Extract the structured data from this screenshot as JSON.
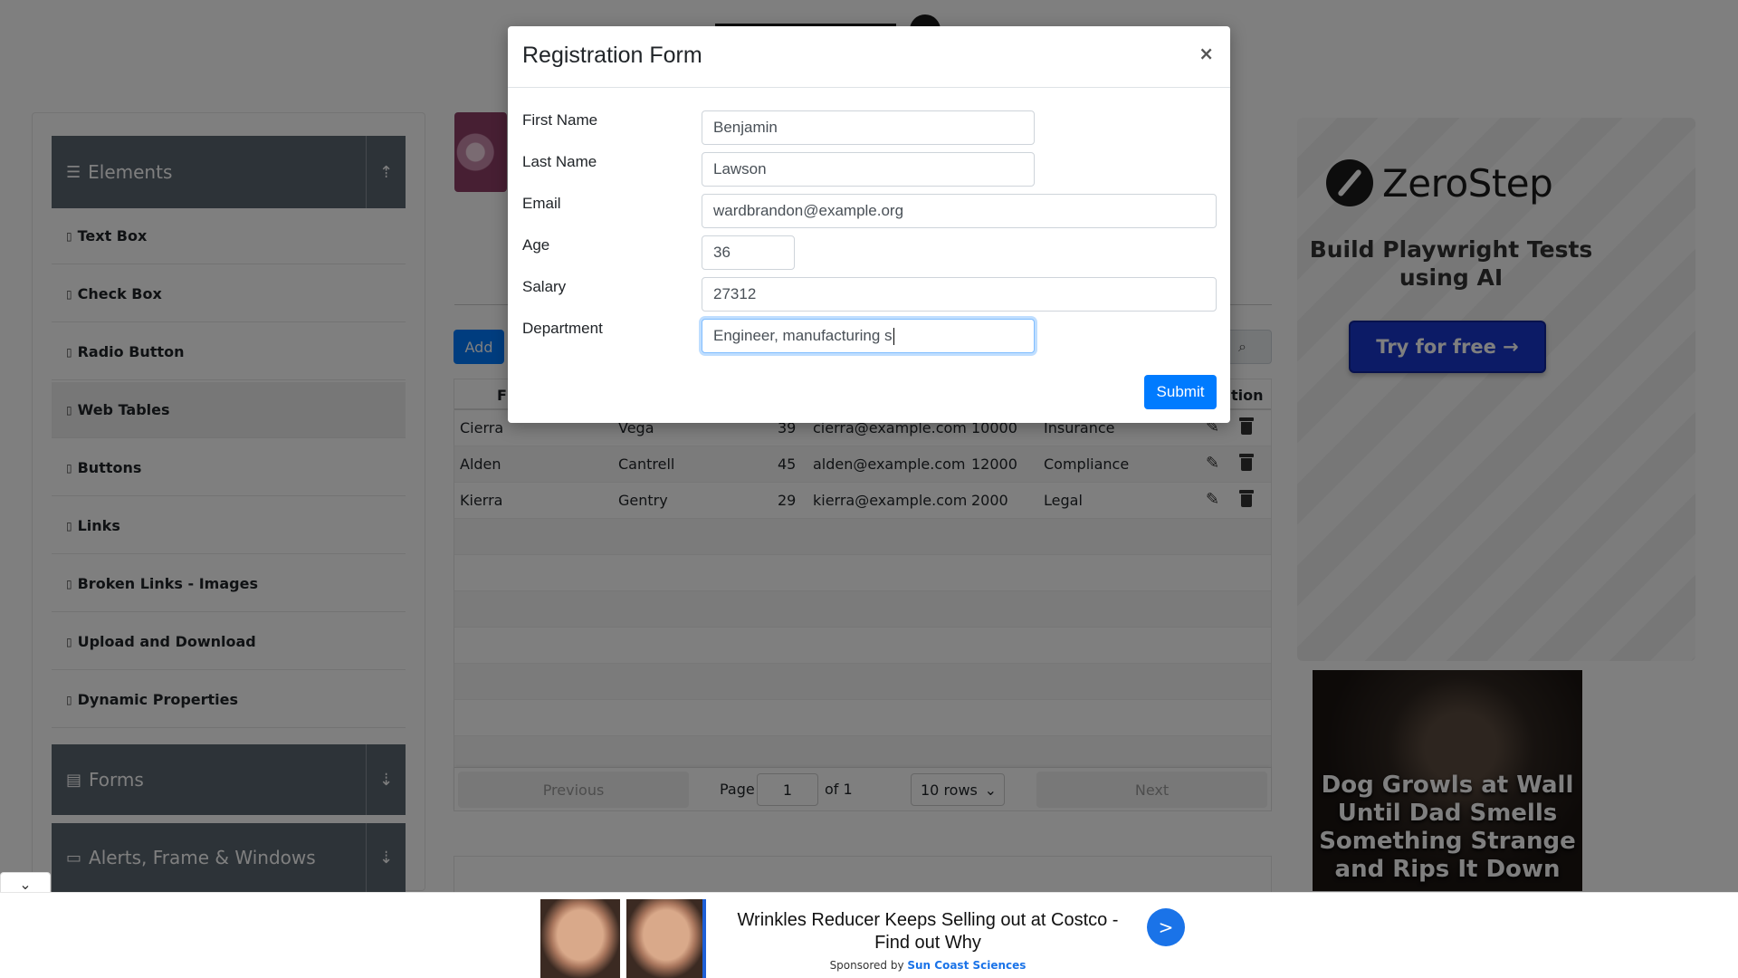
{
  "sidebar": {
    "elements_group": {
      "label": "Elements"
    },
    "items": [
      {
        "label": "Text Box"
      },
      {
        "label": "Check Box"
      },
      {
        "label": "Radio Button"
      },
      {
        "label": "Web Tables"
      },
      {
        "label": "Buttons"
      },
      {
        "label": "Links"
      },
      {
        "label": "Broken Links - Images"
      },
      {
        "label": "Upload and Download"
      },
      {
        "label": "Dynamic Properties"
      }
    ],
    "forms_group": {
      "label": "Forms"
    },
    "alerts_group": {
      "label": "Alerts, Frame & Windows"
    },
    "active_item": "Web Tables"
  },
  "toolbar": {
    "add_label": "Add"
  },
  "table": {
    "visible_header_fragments": {
      "first": "Fi",
      "last": "tion"
    },
    "rows": [
      {
        "first": "Cierra",
        "last": "Vega",
        "age": "39",
        "email": "cierra@example.com",
        "salary": "10000",
        "department": "Insurance"
      },
      {
        "first": "Alden",
        "last": "Cantrell",
        "age": "45",
        "email": "alden@example.com",
        "salary": "12000",
        "department": "Compliance"
      },
      {
        "first": "Kierra",
        "last": "Gentry",
        "age": "29",
        "email": "kierra@example.com",
        "salary": "2000",
        "department": "Legal"
      }
    ],
    "pagination": {
      "previous": "Previous",
      "page_label": "Page",
      "page_value": "1",
      "of_label": "of 1",
      "rows_select": "10 rows",
      "next": "Next"
    }
  },
  "modal": {
    "title": "Registration Form",
    "close": "×",
    "fields": {
      "first_name": {
        "label": "First Name",
        "value": "Benjamin"
      },
      "last_name": {
        "label": "Last Name",
        "value": "Lawson"
      },
      "email": {
        "label": "Email",
        "value": "wardbrandon@example.org"
      },
      "age": {
        "label": "Age",
        "value": "36"
      },
      "salary": {
        "label": "Salary",
        "value": "27312"
      },
      "department": {
        "label": "Department",
        "value": "Engineer, manufacturing s"
      }
    },
    "submit_label": "Submit"
  },
  "ads": {
    "zerostep": {
      "brand": "ZeroStep",
      "tagline": "Build Playwright Tests using AI",
      "cta": "Try for free →"
    },
    "dog": {
      "headline": "Dog Growls at Wall Until Dad Smells Something Strange and Rips It Down"
    },
    "bottom": {
      "headline": "Wrinkles Reducer Keeps Selling out at Costco - Find out Why",
      "sponsored_by": "Sponsored by",
      "sponsor": "Sun Coast Sciences",
      "go": ">"
    }
  },
  "colors": {
    "primary": "#007bff",
    "sidebar_group": "#5a6670",
    "zerostep_button": "#1936cc",
    "sponsor_link": "#1a73e8"
  }
}
